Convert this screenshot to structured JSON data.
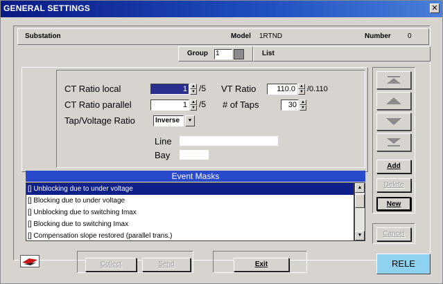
{
  "window": {
    "title": "GENERAL SETTINGS",
    "close_glyph": "✕"
  },
  "header": {
    "substation_label": "Substation",
    "model_label": "Model",
    "model_value": "1RTND",
    "number_label": "Number",
    "number_value": "0"
  },
  "group": {
    "label": "Group",
    "value": "1",
    "list_label": "List"
  },
  "settings": {
    "ct_local_label": "CT Ratio local",
    "ct_local_value": "1",
    "ct_local_unit": "/5",
    "ct_parallel_label": "CT Ratio parallel",
    "ct_parallel_value": "1",
    "ct_parallel_unit": "/5",
    "vt_ratio_label": "VT Ratio",
    "vt_ratio_value": "110.0",
    "vt_ratio_unit": "/0.110",
    "taps_label": "# of Taps",
    "taps_value": "30",
    "tap_voltage_label": "Tap/Voltage Ratio",
    "tap_voltage_value": "Inverse",
    "line_label": "Line",
    "line_value": "",
    "bay_label": "Bay",
    "bay_value": ""
  },
  "event_masks": {
    "header": "Event Masks",
    "items": [
      "[] Unblocking due to under voltage",
      "[] Blocking due to under voltage",
      "[] Unblocking due to  switching Imax",
      "[] Blocking due to switching Imax",
      "[] Compensation slope restored (parallel trans.)"
    ]
  },
  "side_buttons": {
    "add": "Add",
    "delete": "Delete",
    "new": "New",
    "cancel": "Cancel"
  },
  "bottom": {
    "collect": "Collect",
    "send": "Send",
    "exit": "Exit",
    "rele": "RELE"
  },
  "colors": {
    "title_bar": "#0a1a84",
    "selection": "#10208a",
    "rele_bg": "#8fd2f0"
  }
}
